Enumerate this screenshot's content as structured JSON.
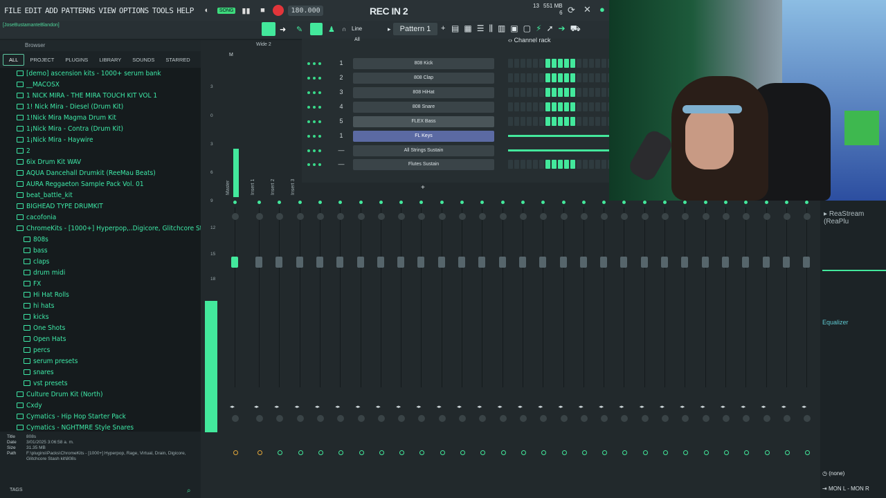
{
  "menubar": {
    "items": [
      "FILE",
      "EDIT",
      "ADD",
      "PATTERNS",
      "VIEW",
      "OPTIONS",
      "TOOLS",
      "HELP"
    ],
    "song_badge": "SONG",
    "tempo": "180.000",
    "rec_in": "REC IN 2",
    "mem_top": "13",
    "mem_mb": "551 MB",
    "mem_bottom": "6"
  },
  "toolbar": {
    "hint_user": "[JoseBustamanteBlandon]",
    "snap": "Line",
    "pattern": "Pattern 1"
  },
  "browser": {
    "title": "Browser",
    "tabs": [
      "ALL",
      "PROJECT",
      "PLUGINS",
      "LIBRARY",
      "SOUNDS",
      "STARRED"
    ],
    "items": [
      {
        "label": "[demo] ascension kits - 1000+ serum bank",
        "level": 1
      },
      {
        "label": "__MACOSX",
        "level": 1
      },
      {
        "label": "1 NICK MIRA - THE MIRA TOUCH KIT VOL 1",
        "level": 1
      },
      {
        "label": "1! Nick Mira - Diesel (Drum Kit)",
        "level": 1
      },
      {
        "label": "1!Nick Mira Magma Drum Kit",
        "level": 1
      },
      {
        "label": "1¡Nick Mira - Contra (Drum Kit)",
        "level": 1
      },
      {
        "label": "1¡Nick Mira - Haywire",
        "level": 1
      },
      {
        "label": "2",
        "level": 1
      },
      {
        "label": "6ix Drum Kit WAV",
        "level": 1
      },
      {
        "label": "AQUA Dancehall Drumkit (ReeMau Beats)",
        "level": 1
      },
      {
        "label": "AURA Reggaeton Sample Pack Vol. 01",
        "level": 1
      },
      {
        "label": "beat_battle_kit",
        "level": 1
      },
      {
        "label": "BIGHEAD TYPE DRUMKIT",
        "level": 1
      },
      {
        "label": "cacofonia",
        "level": 1
      },
      {
        "label": "ChromeKits - [1000+] Hyperpop,..Digicore, Glitchcore Stash kit",
        "level": 1
      },
      {
        "label": "808s",
        "level": 2
      },
      {
        "label": "bass",
        "level": 2
      },
      {
        "label": "claps",
        "level": 2
      },
      {
        "label": "drum midi",
        "level": 2
      },
      {
        "label": "FX",
        "level": 2
      },
      {
        "label": "Hi Hat Rolls",
        "level": 2
      },
      {
        "label": "hi hats",
        "level": 2
      },
      {
        "label": "kicks",
        "level": 2
      },
      {
        "label": "One Shots",
        "level": 2
      },
      {
        "label": "Open Hats",
        "level": 2
      },
      {
        "label": "percs",
        "level": 2
      },
      {
        "label": "serum presets",
        "level": 2
      },
      {
        "label": "snares",
        "level": 2
      },
      {
        "label": "vst presets",
        "level": 2
      },
      {
        "label": "Culture Drum Kit (North)",
        "level": 1
      },
      {
        "label": "Cxdy",
        "level": 1
      },
      {
        "label": "Cymatics - Hip Hop Starter Pack",
        "level": 1
      },
      {
        "label": "Cymatics - NGHTMRE Style Snares",
        "level": 1
      }
    ],
    "info": {
      "title_k": "Title",
      "title_v": "808s",
      "date_k": "Date",
      "date_v": "3/01/2025 3:06:58 a. m.",
      "size_k": "Size",
      "size_v": "31.35 MB",
      "path_k": "Path",
      "path_v": "F:\\plugins\\Packs\\ChromeKits - [1000+] Hyperpop, Rage, Virtual, Drain, Digicore, Glitchcore Stash kit\\808s"
    },
    "tags": "TAGS"
  },
  "mixer": {
    "preset": "Wide 2",
    "scale": [
      "3",
      "0",
      "3",
      "6",
      "9",
      "12",
      "15",
      "18"
    ],
    "master_label": "M",
    "strip_labels": [
      "Master",
      "Insert 1",
      "Insert 2",
      "Insert 3"
    ]
  },
  "channel_rack": {
    "title": "Channel rack",
    "filter": "All",
    "channels": [
      {
        "num": "1",
        "name": "808 Kick",
        "steps": [
          0,
          0,
          0,
          0,
          0,
          0,
          1,
          1,
          1,
          1,
          1,
          0,
          0,
          0,
          0,
          0,
          0,
          1,
          1,
          1
        ]
      },
      {
        "num": "2",
        "name": "808 Clap",
        "steps": [
          0,
          0,
          0,
          0,
          0,
          0,
          1,
          1,
          1,
          1,
          1,
          0,
          0,
          0,
          0,
          0,
          0,
          1,
          1,
          1
        ]
      },
      {
        "num": "3",
        "name": "808 HiHat",
        "steps": [
          0,
          0,
          0,
          0,
          0,
          0,
          1,
          1,
          1,
          1,
          1,
          0,
          0,
          0,
          0,
          0,
          0,
          1,
          1,
          1
        ]
      },
      {
        "num": "4",
        "name": "808 Snare",
        "steps": [
          0,
          0,
          0,
          0,
          0,
          0,
          1,
          1,
          1,
          1,
          1,
          0,
          0,
          0,
          0,
          0,
          0,
          1,
          1,
          1
        ]
      },
      {
        "num": "5",
        "name": "FLEX Bass",
        "steps": [
          0,
          0,
          0,
          0,
          0,
          0,
          1,
          1,
          1,
          1,
          1,
          0,
          0,
          0,
          0,
          0,
          0,
          1,
          1,
          1
        ]
      },
      {
        "num": "1",
        "name": "FL Keys",
        "steps": []
      },
      {
        "num": "—",
        "name": "All Strings Sustain",
        "steps": []
      },
      {
        "num": "—",
        "name": "Flutes Sustain",
        "steps": [
          0,
          0,
          0,
          0,
          0,
          0,
          1,
          1,
          1,
          1,
          1,
          0,
          0,
          0,
          0,
          0,
          0,
          1,
          1,
          1
        ]
      }
    ]
  },
  "right_panel": {
    "plugin": "ReaStream (ReaPlu",
    "equalizer": "Equalizer",
    "route": "(none)",
    "monitor": "MON L - MON R"
  }
}
